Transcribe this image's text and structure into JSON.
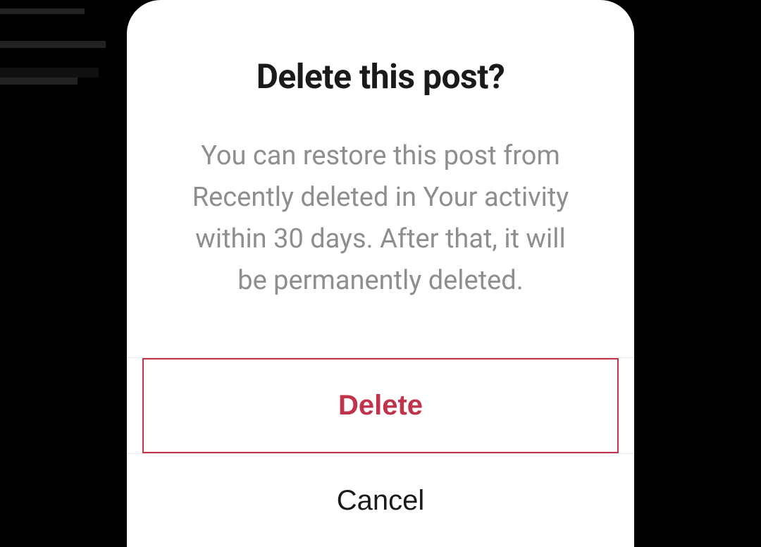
{
  "dialog": {
    "title": "Delete this post?",
    "body": "You can restore this post from Recently deleted in Your activ­ity within 30 days. After that, it will be permanently deleted.",
    "delete_label": "Delete",
    "cancel_label": "Cancel",
    "colors": {
      "danger": "#c1334a",
      "text_primary": "#1a1a1a",
      "text_secondary": "#8e8e8e"
    }
  }
}
